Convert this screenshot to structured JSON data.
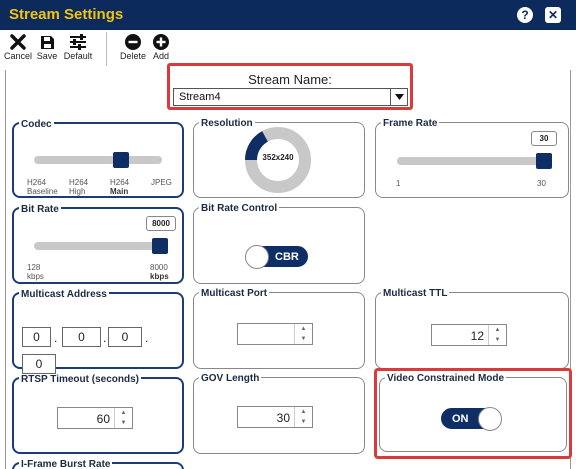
{
  "window": {
    "title": "Stream Settings",
    "help_glyph": "?",
    "close_glyph": "✕"
  },
  "toolbar": {
    "cancel_label": "Cancel",
    "save_label": "Save",
    "default_label": "Default",
    "delete_label": "Delete",
    "add_label": "Add"
  },
  "stream_name": {
    "label": "Stream Name:",
    "value": "Stream4"
  },
  "codec": {
    "title": "Codec",
    "options": [
      {
        "line1": "H264",
        "line2": "Baseline"
      },
      {
        "line1": "H264",
        "line2": "High"
      },
      {
        "line1": "H264",
        "line2": "Main"
      },
      {
        "line1": "JPEG",
        "line2": ""
      }
    ],
    "selected_index": 2
  },
  "resolution": {
    "title": "Resolution",
    "value": "352x240",
    "fraction": 0.17
  },
  "frame_rate": {
    "title": "Frame Rate",
    "value": "30",
    "min": "1",
    "max": "30",
    "fraction": 1.0
  },
  "bit_rate": {
    "title": "Bit Rate",
    "value": "8000",
    "min_value": "128",
    "min_unit": "kbps",
    "max_value": "8000",
    "max_unit": "kbps",
    "fraction": 1.0
  },
  "bit_rate_control": {
    "title": "Bit Rate Control",
    "value": "CBR"
  },
  "multicast_address": {
    "title": "Multicast Address",
    "octets": [
      "0",
      "0",
      "0",
      "0"
    ],
    "separator": "."
  },
  "multicast_port": {
    "title": "Multicast Port",
    "value": ""
  },
  "multicast_ttl": {
    "title": "Multicast TTL",
    "value": "12"
  },
  "rtsp_timeout": {
    "title": "RTSP Timeout (seconds)",
    "value": "60"
  },
  "gov_length": {
    "title": "GOV Length",
    "value": "30"
  },
  "video_constrained_mode": {
    "title": "Video Constrained Mode",
    "value": "ON"
  },
  "iframe_burst_rate": {
    "title": "I-Frame Burst Rate"
  },
  "spin_arrows": {
    "up": "▲",
    "down": "▼"
  },
  "colors": {
    "titlebar": "#0d2a5c",
    "title_text": "#f1c40f",
    "accent": "#102e66",
    "highlight": "#d93b3b",
    "track": "#c8c8c8"
  }
}
